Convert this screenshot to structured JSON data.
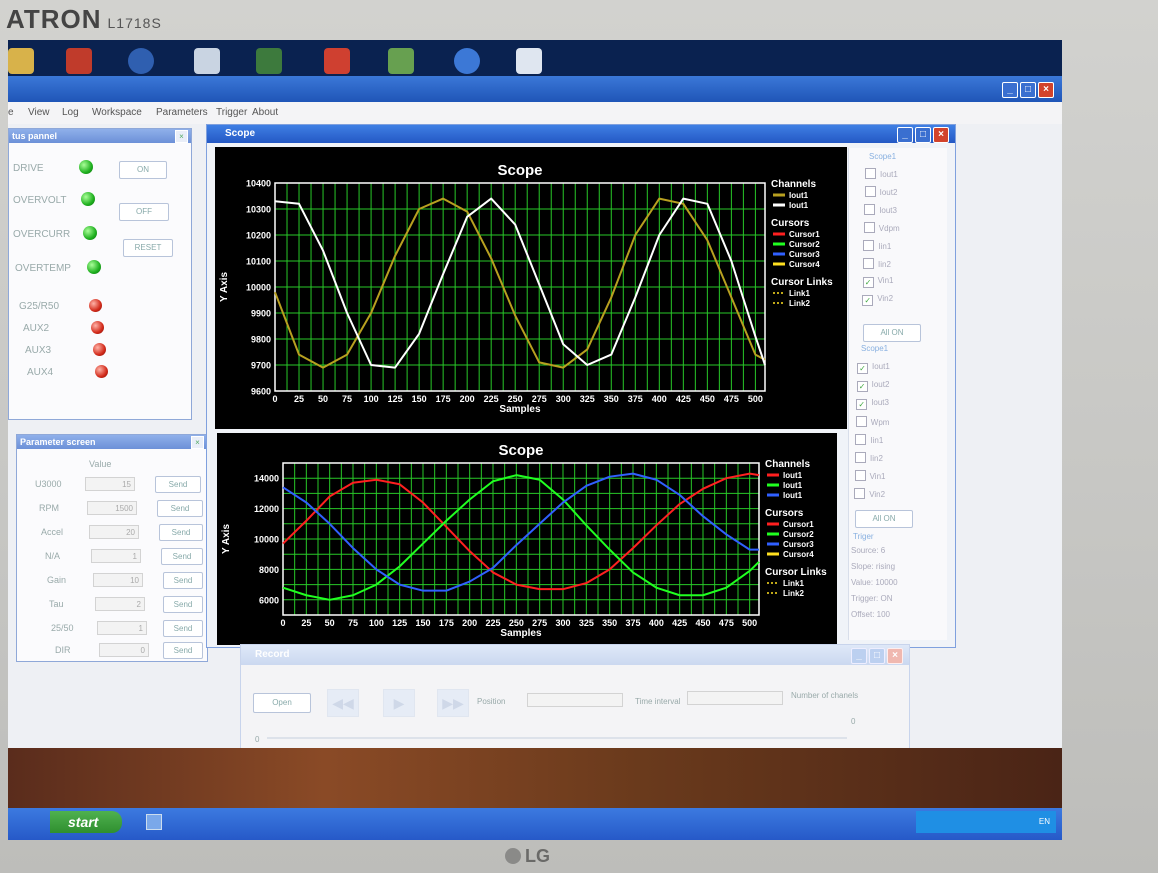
{
  "monitor": {
    "brand": "ATRON",
    "model": "L1718S",
    "maker_logo": "LG"
  },
  "menu": [
    "e",
    "View",
    "Log",
    "Workspace",
    "Parameters",
    "Trigger",
    "About"
  ],
  "status_panel": {
    "title": "tus pannel",
    "items": [
      {
        "label": "DRIVE",
        "led": "green"
      },
      {
        "label": "OVERVOLT",
        "led": "green"
      },
      {
        "label": "OVERCURR",
        "led": "green"
      },
      {
        "label": "OVERTEMP",
        "led": "green"
      },
      {
        "label": "G25/R50",
        "led": "red"
      },
      {
        "label": "AUX2",
        "led": "red"
      },
      {
        "label": "AUX3",
        "led": "red"
      },
      {
        "label": "AUX4",
        "led": "red"
      }
    ],
    "buttons": [
      "ON",
      "OFF",
      "RESET"
    ]
  },
  "param_screen": {
    "title": "Parameter screen",
    "value_header": "Value",
    "rows": [
      {
        "label": "U3000",
        "value": "15",
        "button": "Send"
      },
      {
        "label": "RPM",
        "value": "1500",
        "button": "Send"
      },
      {
        "label": "Accel",
        "value": "20",
        "button": "Send"
      },
      {
        "label": "N/A",
        "value": "1",
        "button": "Send"
      },
      {
        "label": "Gain",
        "value": "10",
        "button": "Send"
      },
      {
        "label": "Tau",
        "value": "2",
        "button": "Send"
      },
      {
        "label": "25/50",
        "value": "1",
        "button": "Send"
      },
      {
        "label": "DIR",
        "value": "0",
        "button": "Send"
      }
    ]
  },
  "scope_window": {
    "title": "Scope",
    "group1": {
      "label": "Scope1",
      "items": [
        {
          "label": "Iout1",
          "checked": false
        },
        {
          "label": "Iout2",
          "checked": false
        },
        {
          "label": "Iout3",
          "checked": false
        },
        {
          "label": "Vdpm",
          "checked": false
        },
        {
          "label": "Iin1",
          "checked": false
        },
        {
          "label": "Iin2",
          "checked": false
        },
        {
          "label": "Vin1",
          "checked": true
        },
        {
          "label": "Vin2",
          "checked": true
        }
      ],
      "button": "All ON"
    },
    "group2": {
      "label": "Scope1",
      "items": [
        {
          "label": "Iout1",
          "checked": true
        },
        {
          "label": "Iout2",
          "checked": true
        },
        {
          "label": "Iout3",
          "checked": true
        },
        {
          "label": "Wpm",
          "checked": false
        },
        {
          "label": "Iin1",
          "checked": false
        },
        {
          "label": "Iin2",
          "checked": false
        },
        {
          "label": "Vin1",
          "checked": false
        },
        {
          "label": "Vin2",
          "checked": false
        }
      ],
      "button": "All ON"
    },
    "trigger": {
      "label": "Triger",
      "lines": [
        "Source: 6",
        "Slope:  rising",
        "Value:  10000",
        "Trigger: ON",
        "Offset:  100"
      ]
    }
  },
  "record_window": {
    "title": "Record",
    "open_button": "Open",
    "position_label": "Position",
    "interval_label": "Time interval",
    "channels_label": "Number of chanels",
    "slider_min": "0",
    "slider_max": "0"
  },
  "taskbar": {
    "start_label": "start",
    "tray_text": "EN"
  },
  "chart_data": [
    {
      "type": "line",
      "title": "Scope",
      "xlabel": "Samples",
      "ylabel": "Y Axis",
      "xlim": [
        0,
        510
      ],
      "ylim": [
        9600,
        10400
      ],
      "x_ticks": [
        0,
        25,
        50,
        75,
        100,
        125,
        150,
        175,
        200,
        225,
        250,
        275,
        300,
        325,
        350,
        375,
        400,
        425,
        450,
        475,
        500
      ],
      "y_ticks": [
        9600,
        9700,
        9800,
        9900,
        10000,
        10100,
        10200,
        10300,
        10400
      ],
      "grid": true,
      "legend": {
        "channels_title": "Channels",
        "channels": [
          {
            "name": "Iout1",
            "color": "#b8a020"
          },
          {
            "name": "Iout1",
            "color": "#ffffff"
          }
        ],
        "cursors_title": "Cursors",
        "cursors": [
          {
            "name": "Cursor1",
            "color": "#ff2020"
          },
          {
            "name": "Cursor2",
            "color": "#20ff20"
          },
          {
            "name": "Cursor3",
            "color": "#3060ff"
          },
          {
            "name": "Cursor4",
            "color": "#ffe020"
          }
        ],
        "links_title": "Cursor Links",
        "links": [
          "Link1",
          "Link2"
        ]
      },
      "series": [
        {
          "name": "Iout1",
          "color": "#b8a020",
          "x": [
            0,
            25,
            50,
            75,
            100,
            125,
            150,
            175,
            200,
            225,
            250,
            275,
            300,
            325,
            350,
            375,
            400,
            425,
            450,
            475,
            500,
            510
          ],
          "y": [
            9980,
            9740,
            9690,
            9740,
            9900,
            10120,
            10300,
            10340,
            10290,
            10110,
            9890,
            9710,
            9690,
            9760,
            9960,
            10200,
            10340,
            10320,
            10180,
            9960,
            9740,
            9720
          ]
        },
        {
          "name": "Iout1",
          "color": "#ffffff",
          "x": [
            0,
            25,
            50,
            75,
            100,
            125,
            150,
            175,
            200,
            225,
            250,
            275,
            300,
            325,
            350,
            375,
            400,
            425,
            450,
            475,
            500,
            510
          ],
          "y": [
            10330,
            10320,
            10140,
            9900,
            9700,
            9690,
            9820,
            10050,
            10270,
            10340,
            10240,
            10010,
            9780,
            9700,
            9740,
            9960,
            10200,
            10340,
            10320,
            10100,
            9810,
            9700
          ]
        }
      ]
    },
    {
      "type": "line",
      "title": "Scope",
      "xlabel": "Samples",
      "ylabel": "Y Axis",
      "xlim": [
        0,
        510
      ],
      "ylim": [
        5000,
        15000
      ],
      "x_ticks": [
        0,
        25,
        50,
        75,
        100,
        125,
        150,
        175,
        200,
        225,
        250,
        275,
        300,
        325,
        350,
        375,
        400,
        425,
        450,
        475,
        500
      ],
      "y_ticks": [
        6000,
        8000,
        10000,
        12000,
        14000
      ],
      "grid": true,
      "legend": {
        "channels_title": "Channels",
        "channels": [
          {
            "name": "Iout1",
            "color": "#ff2020"
          },
          {
            "name": "Iout1",
            "color": "#20ff20"
          },
          {
            "name": "Iout1",
            "color": "#3060ff"
          }
        ],
        "cursors_title": "Cursors",
        "cursors": [
          {
            "name": "Cursor1",
            "color": "#ff2020"
          },
          {
            "name": "Cursor2",
            "color": "#20ff20"
          },
          {
            "name": "Cursor3",
            "color": "#3060ff"
          },
          {
            "name": "Cursor4",
            "color": "#ffe020"
          }
        ],
        "links_title": "Cursor Links",
        "links": [
          "Link1",
          "Link2"
        ]
      },
      "series": [
        {
          "name": "Iout1",
          "color": "#ff2020",
          "x": [
            0,
            25,
            50,
            75,
            100,
            125,
            150,
            175,
            200,
            225,
            250,
            275,
            300,
            325,
            350,
            375,
            400,
            425,
            450,
            475,
            500,
            510
          ],
          "y": [
            9700,
            11200,
            12800,
            13700,
            13900,
            13600,
            12400,
            10800,
            9200,
            7800,
            7000,
            6700,
            6700,
            7100,
            8000,
            9400,
            10900,
            12300,
            13300,
            14000,
            14300,
            14200
          ]
        },
        {
          "name": "Iout1",
          "color": "#20ff20",
          "x": [
            0,
            25,
            50,
            75,
            100,
            125,
            150,
            175,
            200,
            225,
            250,
            275,
            300,
            325,
            350,
            375,
            400,
            425,
            450,
            475,
            500,
            510
          ],
          "y": [
            6800,
            6300,
            6000,
            6300,
            7000,
            8200,
            9700,
            11200,
            12600,
            13800,
            14200,
            13900,
            12600,
            10900,
            9300,
            7800,
            6800,
            6300,
            6300,
            6800,
            7900,
            8500
          ]
        },
        {
          "name": "Iout1",
          "color": "#3060ff",
          "x": [
            0,
            25,
            50,
            75,
            100,
            125,
            150,
            175,
            200,
            225,
            250,
            275,
            300,
            325,
            350,
            375,
            400,
            425,
            450,
            475,
            500,
            510
          ],
          "y": [
            13400,
            12400,
            11000,
            9400,
            8000,
            7000,
            6600,
            6600,
            7200,
            8100,
            9600,
            11000,
            12400,
            13500,
            14100,
            14300,
            13900,
            12900,
            11500,
            10300,
            9300,
            9300
          ]
        }
      ]
    }
  ]
}
